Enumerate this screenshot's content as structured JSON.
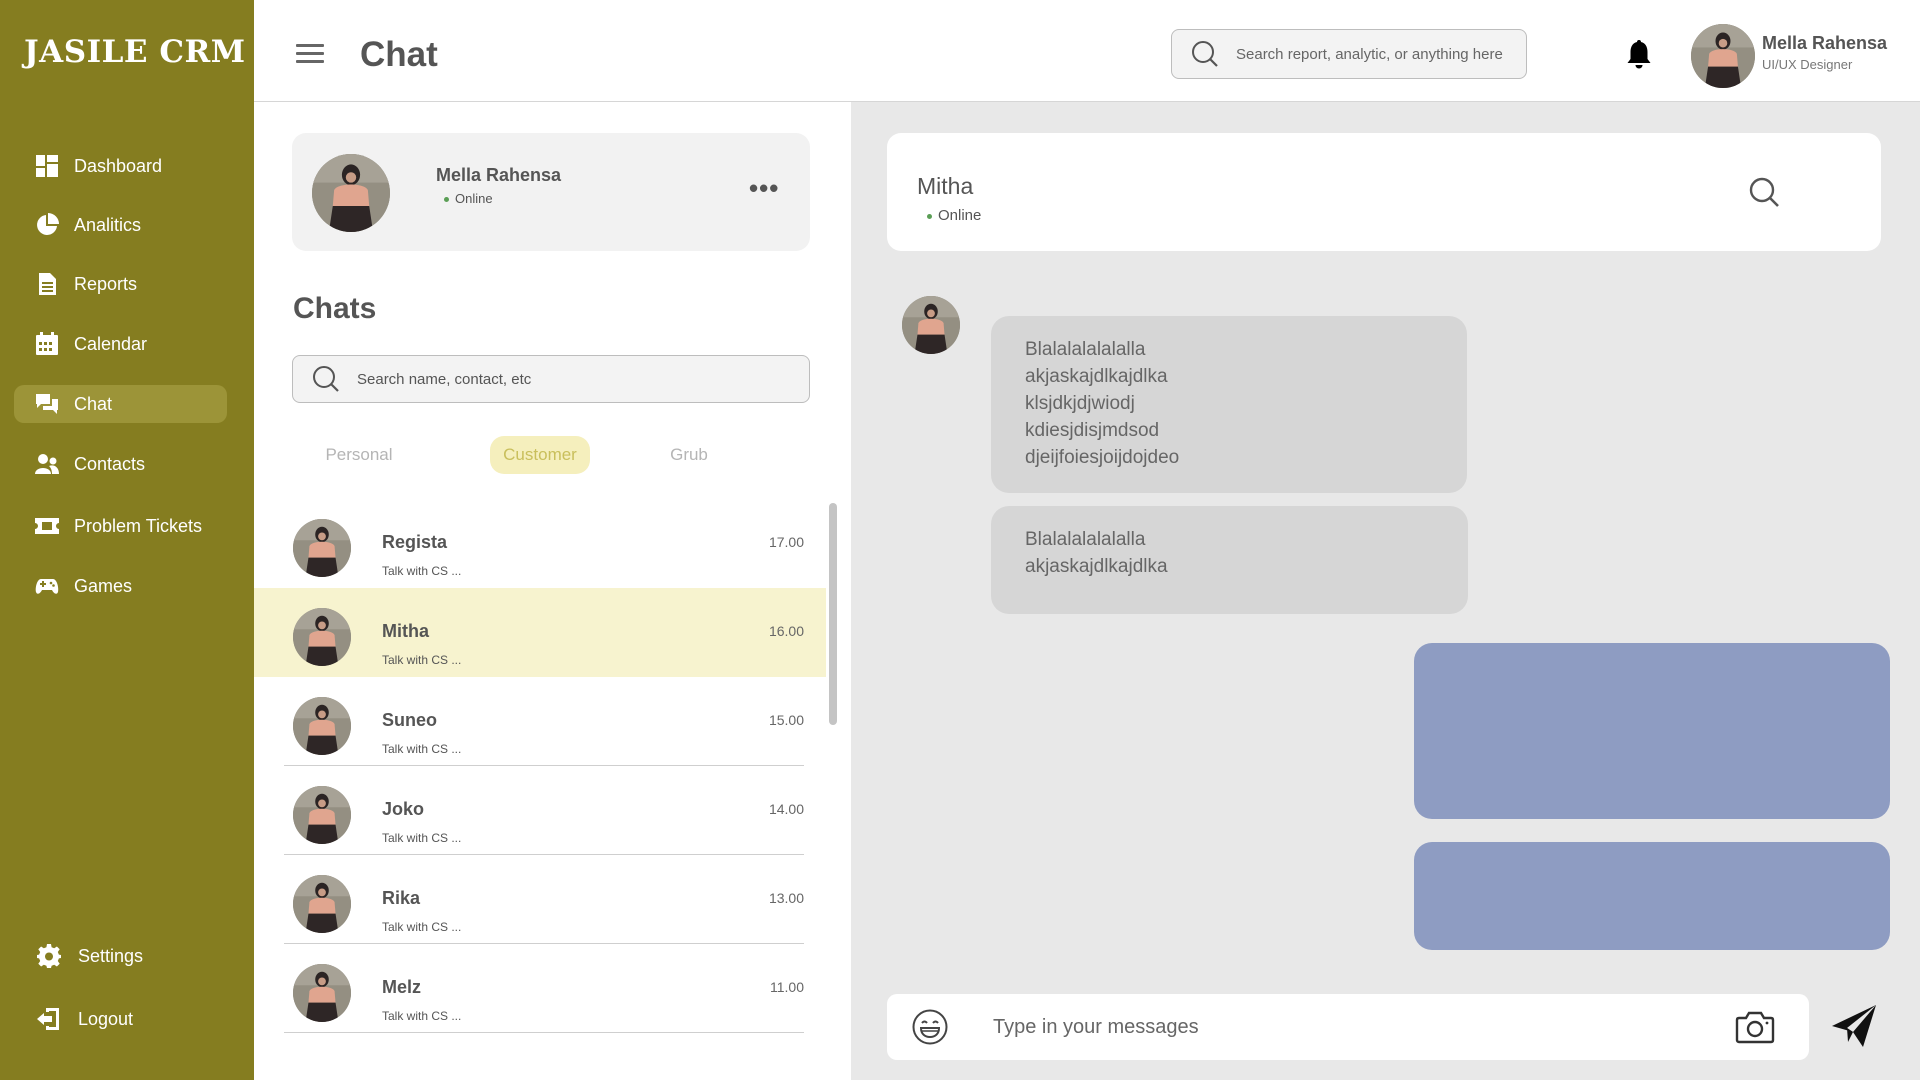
{
  "app": {
    "brand": "JASILE CRM",
    "page_title": "Chat"
  },
  "sidebar": {
    "items": [
      {
        "label": "Dashboard",
        "icon": "dashboard-icon"
      },
      {
        "label": "Analitics",
        "icon": "pie-chart-icon"
      },
      {
        "label": "Reports",
        "icon": "document-icon"
      },
      {
        "label": "Calendar",
        "icon": "calendar-icon"
      },
      {
        "label": "Chat",
        "icon": "chat-icon",
        "active": true
      },
      {
        "label": "Contacts",
        "icon": "contacts-icon"
      },
      {
        "label": "Problem Tickets",
        "icon": "ticket-icon"
      },
      {
        "label": "Games",
        "icon": "gamepad-icon"
      }
    ],
    "bottom": [
      {
        "label": "Settings",
        "icon": "gear-icon"
      },
      {
        "label": "Logout",
        "icon": "logout-icon"
      }
    ]
  },
  "header": {
    "search_placeholder": "Search report, analytic, or anything here",
    "user": {
      "name": "Mella Rahensa",
      "role": "UI/UX Designer"
    }
  },
  "profile_card": {
    "name": "Mella Rahensa",
    "status": "Online",
    "more": "•••"
  },
  "chats": {
    "heading": "Chats",
    "search_placeholder": "Search name, contact, etc",
    "tabs": [
      {
        "label": "Personal",
        "active": false
      },
      {
        "label": "Customer",
        "active": true
      },
      {
        "label": "Grub",
        "active": false
      }
    ],
    "items": [
      {
        "name": "Regista",
        "preview": "Talk with CS ...",
        "time": "17.00"
      },
      {
        "name": "Mitha",
        "preview": "Talk with CS ...",
        "time": "16.00",
        "active": true
      },
      {
        "name": "Suneo",
        "preview": "Talk with CS ...",
        "time": "15.00"
      },
      {
        "name": "Joko",
        "preview": "Talk with CS ...",
        "time": "14.00"
      },
      {
        "name": "Rika",
        "preview": "Talk with CS ...",
        "time": "13.00"
      },
      {
        "name": "Melz",
        "preview": "Talk with CS ...",
        "time": "11.00"
      }
    ]
  },
  "conversation": {
    "contact": {
      "name": "Mitha",
      "status": "Online"
    },
    "messages_in": [
      {
        "lines": [
          "Blalalalalalalla",
          "akjaskajdlkajdlka",
          "klsjdkjdjwiodj",
          "kdiesjdisjmdsod",
          "djeijfoiesjoijdojdeo"
        ]
      },
      {
        "lines": [
          "Blalalalalalalla",
          "akjaskajdlkajdlka"
        ]
      }
    ],
    "composer_placeholder": "Type in your messages"
  },
  "colors": {
    "sidebar": "#857d20",
    "sidebar_active": "#9c9438",
    "active_row": "#f7f3cf",
    "tab_active_bg": "#f5efbd",
    "bubble_in": "#d6d6d6",
    "bubble_out": "#8e9cc2",
    "online": "#5a9e55"
  }
}
